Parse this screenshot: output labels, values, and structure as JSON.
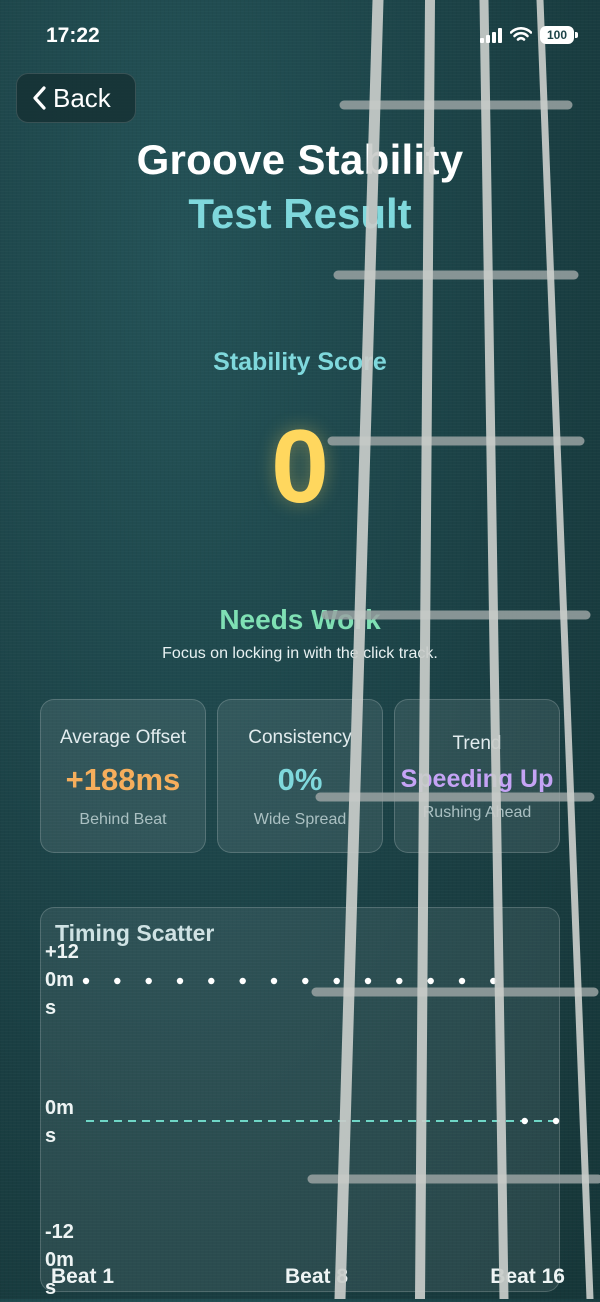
{
  "status_bar": {
    "time": "17:22",
    "battery": "100"
  },
  "nav": {
    "back_label": "Back"
  },
  "header": {
    "title": "Groove Stability",
    "subtitle": "Test Result"
  },
  "score": {
    "label": "Stability Score",
    "value": "0"
  },
  "verdict": {
    "title": "Needs Work",
    "message": "Focus on locking in with the click track."
  },
  "metrics": [
    {
      "title": "Average Offset",
      "value": "+188ms",
      "description": "Behind Beat",
      "color": "#f6ae5c"
    },
    {
      "title": "Consistency",
      "value": "0%",
      "description": "Wide Spread",
      "color": "#7fd8dc"
    },
    {
      "title": "Trend",
      "value": "Speeding Up",
      "description": "Rushing Ahead",
      "color": "#c5a3f5"
    }
  ],
  "scatter": {
    "title": "Timing Scatter",
    "y_labels": {
      "top": "+120ms",
      "mid": "0ms",
      "bottom": "-120ms"
    },
    "x_labels": {
      "start": "Beat 1",
      "mid": "Beat 8",
      "end": "Beat 16"
    },
    "zero_line_color": "#6fd6c6",
    "point_color": "#ffffff",
    "y_range_ms": [
      -120,
      120
    ],
    "beats": [
      1,
      2,
      3,
      4,
      5,
      6,
      7,
      8,
      9,
      10,
      11,
      12,
      13,
      14,
      15,
      16
    ],
    "offsets_ms": [
      120,
      120,
      120,
      120,
      120,
      120,
      120,
      120,
      120,
      120,
      120,
      120,
      120,
      120,
      0,
      0
    ]
  }
}
